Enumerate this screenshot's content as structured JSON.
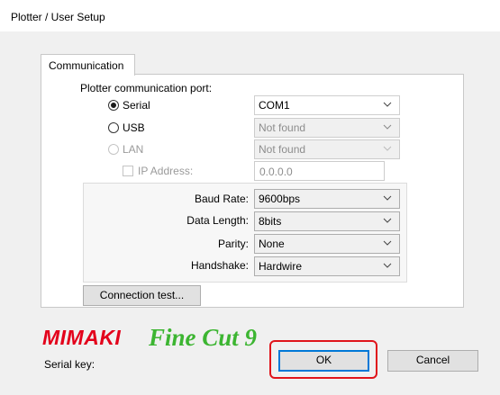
{
  "window": {
    "title": "Plotter / User Setup"
  },
  "tabs": [
    {
      "label": "Communication"
    }
  ],
  "port": {
    "heading": "Plotter communication port:",
    "serial": {
      "label": "Serial",
      "value": "COM1"
    },
    "usb": {
      "label": "USB",
      "value": "Not found"
    },
    "lan": {
      "label": "LAN",
      "value": "Not found"
    },
    "ip": {
      "label": "IP Address:",
      "value": "0.0.0.0"
    }
  },
  "settings": {
    "baud": {
      "label": "Baud Rate:",
      "value": "9600bps"
    },
    "data_length": {
      "label": "Data Length:",
      "value": "8bits"
    },
    "parity": {
      "label": "Parity:",
      "value": "None"
    },
    "handshake": {
      "label": "Handshake:",
      "value": "Hardwire"
    }
  },
  "connection_test_label": "Connection test...",
  "logo": {
    "brand": "MIMAKI",
    "product": "Fine Cut 9"
  },
  "serial_key_label": "Serial key:",
  "buttons": {
    "ok": "OK",
    "cancel": "Cancel"
  },
  "colors": {
    "logo_red": "#e3001b",
    "logo_green": "#3cb531",
    "ok_highlight": "#e0141b",
    "focus_blue": "#0078d7"
  },
  "icons": [
    "chevron-down-icon",
    "radio-button",
    "checkbox"
  ]
}
